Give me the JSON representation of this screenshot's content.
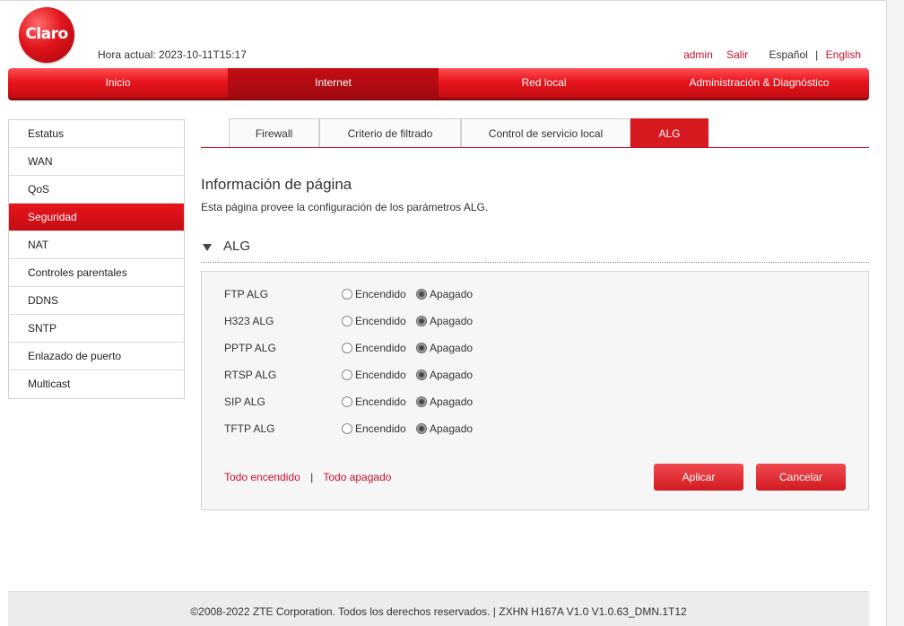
{
  "header": {
    "logo_text": "Claro",
    "current_time_label": "Hora actual: 2023-10-11T15:17",
    "user": "admin",
    "logout": "Salir",
    "lang_es": "Español",
    "lang_sep": "|",
    "lang_en": "English"
  },
  "main_nav": [
    {
      "label": "Inicio",
      "active": false
    },
    {
      "label": "Internet",
      "active": true
    },
    {
      "label": "Red local",
      "active": false
    },
    {
      "label": "Administración & Diagnóstico",
      "active": false
    }
  ],
  "sidebar": [
    {
      "label": "Estatus"
    },
    {
      "label": "WAN"
    },
    {
      "label": "QoS"
    },
    {
      "label": "Seguridad",
      "active": true
    },
    {
      "label": "NAT"
    },
    {
      "label": "Controles parentales"
    },
    {
      "label": "DDNS"
    },
    {
      "label": "SNTP"
    },
    {
      "label": "Enlazado de puerto"
    },
    {
      "label": "Multicast"
    }
  ],
  "tabs": [
    {
      "label": "Firewall"
    },
    {
      "label": "Criterio de filtrado"
    },
    {
      "label": "Control de servicio local"
    },
    {
      "label": "ALG",
      "active": true
    }
  ],
  "page": {
    "title": "Información de página",
    "description": "Esta página provee la configuración de los parámetros ALG."
  },
  "section": {
    "title": "ALG"
  },
  "alg_rows": [
    {
      "label": "FTP ALG",
      "on_label": "Encendido",
      "off_label": "Apagado",
      "value": "off"
    },
    {
      "label": "H323 ALG",
      "on_label": "Encendido",
      "off_label": "Apagado",
      "value": "off"
    },
    {
      "label": "PPTP ALG",
      "on_label": "Encendido",
      "off_label": "Apagado",
      "value": "off"
    },
    {
      "label": "RTSP ALG",
      "on_label": "Encendido",
      "off_label": "Apagado",
      "value": "off"
    },
    {
      "label": "SIP ALG",
      "on_label": "Encendido",
      "off_label": "Apagado",
      "value": "off"
    },
    {
      "label": "TFTP ALG",
      "on_label": "Encendido",
      "off_label": "Apagado",
      "value": "off"
    }
  ],
  "actions": {
    "all_on": "Todo encendido",
    "sep": "|",
    "all_off": "Todo apagado",
    "apply": "Aplicar",
    "cancel": "Cancelar"
  },
  "footer": {
    "text": "©2008-2022 ZTE Corporation. Todos los derechos reservados.  |  ZXHN H167A V1.0 V1.0.63_DMN.1T12"
  },
  "colors": {
    "brand_red": "#d71920",
    "link_red": "#c8102e"
  }
}
